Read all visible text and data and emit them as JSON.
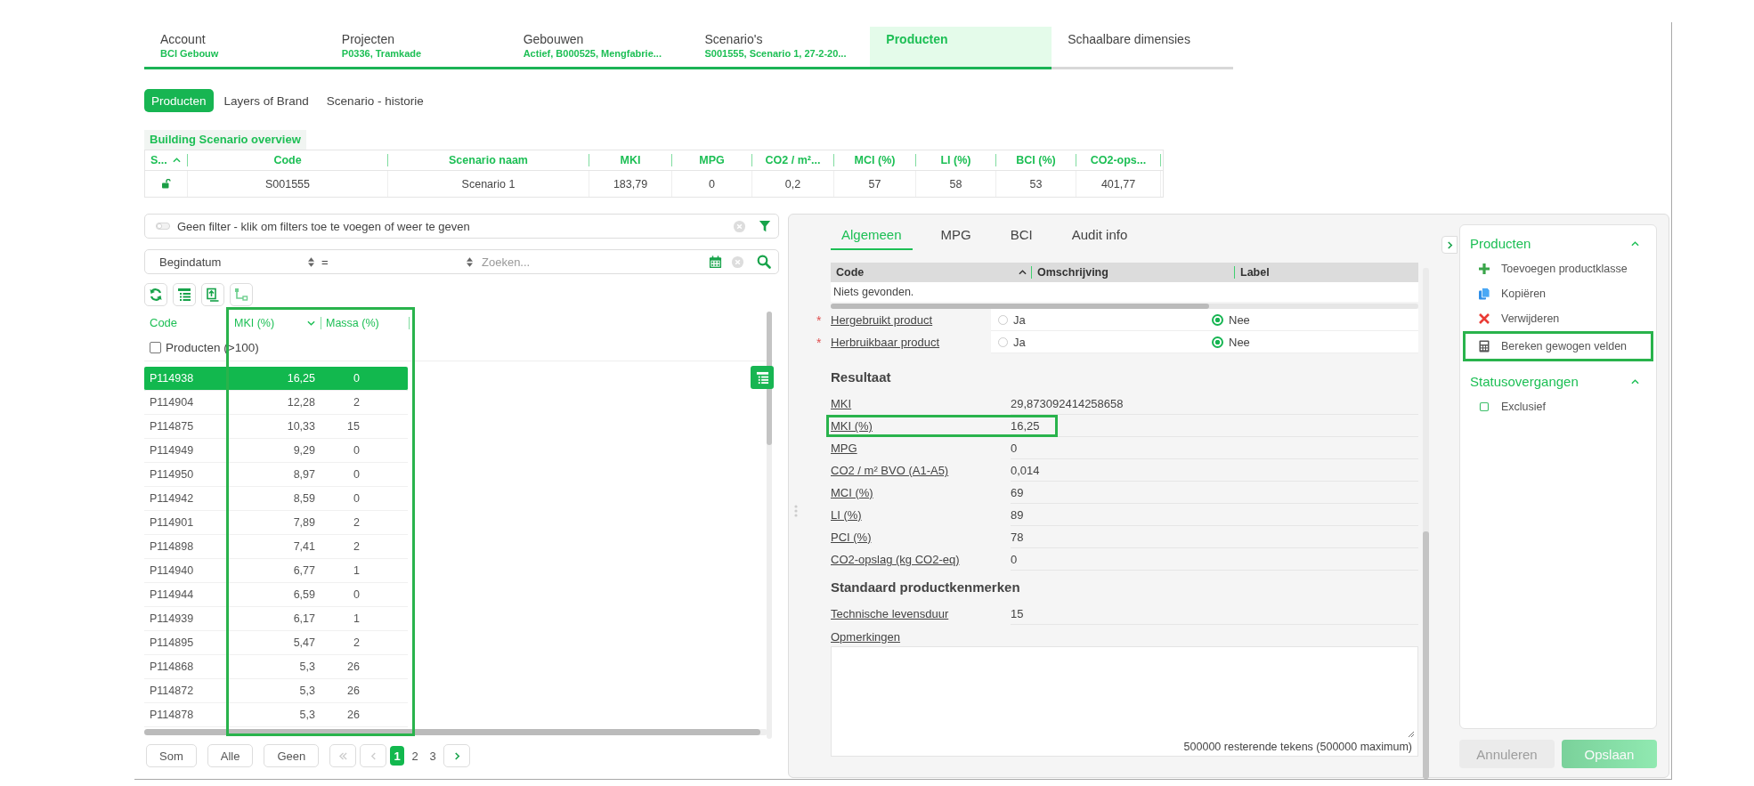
{
  "top_tabs": [
    {
      "label": "Account",
      "sublabel": "BCI Gebouw",
      "selected": false
    },
    {
      "label": "Projecten",
      "sublabel": "P0336, Tramkade",
      "selected": false
    },
    {
      "label": "Gebouwen",
      "sublabel": "Actief, B000525, Mengfabrie...",
      "selected": false
    },
    {
      "label": "Scenario's",
      "sublabel": "S001555, Scenario 1, 27-2-20...",
      "selected": false
    },
    {
      "label": "Producten",
      "selected": true
    },
    {
      "label": "Schaalbare dimensies",
      "selected": false
    }
  ],
  "sub_tabs": [
    {
      "label": "Producten",
      "selected": true
    },
    {
      "label": "Layers of Brand",
      "selected": false
    },
    {
      "label": "Scenario - historie",
      "selected": false
    }
  ],
  "overview": {
    "title": "Building Scenario overview",
    "columns": [
      {
        "label": "S...",
        "ascending": true
      },
      {
        "label": "Code"
      },
      {
        "label": "Scenario naam"
      },
      {
        "label": "MKI"
      },
      {
        "label": "MPG"
      },
      {
        "label": "CO2 / m²..."
      },
      {
        "label": "MCI (%)"
      },
      {
        "label": "LI (%)"
      },
      {
        "label": "BCI (%)"
      },
      {
        "label": "CO2-ops..."
      }
    ],
    "rows": [
      {
        "cells": [
          "",
          "S001555",
          "Scenario 1",
          "183,79",
          "0",
          "0,2",
          "57",
          "58",
          "53",
          "401,77"
        ]
      }
    ]
  },
  "filter_bar": {
    "text": "Geen filter - klik om filters toe te voegen of weer te geven"
  },
  "search_bar": {
    "field": "Begindatum",
    "operator": "=",
    "placeholder": "Zoeken..."
  },
  "products_table": {
    "columns": [
      {
        "label": "Code"
      },
      {
        "label": "MKI (%)",
        "ascending": false
      },
      {
        "label": "Massa (%)"
      }
    ],
    "outlined": true,
    "group": {
      "label": "Producten (>100)",
      "checked": false
    },
    "rows": [
      {
        "code": "P114938",
        "mki": "16,25",
        "massa": "0",
        "selected": true
      },
      {
        "code": "P114904",
        "mki": "12,28",
        "massa": "2",
        "selected": false
      },
      {
        "code": "P114875",
        "mki": "10,33",
        "massa": "15",
        "selected": false
      },
      {
        "code": "P114949",
        "mki": "9,29",
        "massa": "0",
        "selected": false
      },
      {
        "code": "P114950",
        "mki": "8,97",
        "massa": "0",
        "selected": false
      },
      {
        "code": "P114942",
        "mki": "8,59",
        "massa": "0",
        "selected": false
      },
      {
        "code": "P114901",
        "mki": "7,89",
        "massa": "2",
        "selected": false
      },
      {
        "code": "P114898",
        "mki": "7,41",
        "massa": "2",
        "selected": false
      },
      {
        "code": "P114940",
        "mki": "6,77",
        "massa": "1",
        "selected": false
      },
      {
        "code": "P114944",
        "mki": "6,59",
        "massa": "0",
        "selected": false
      },
      {
        "code": "P114939",
        "mki": "6,17",
        "massa": "1",
        "selected": false
      },
      {
        "code": "P114895",
        "mki": "5,47",
        "massa": "2",
        "selected": false
      },
      {
        "code": "P114868",
        "mki": "5,3",
        "massa": "26",
        "selected": false
      },
      {
        "code": "P114872",
        "mki": "5,3",
        "massa": "26",
        "selected": false
      },
      {
        "code": "P114878",
        "mki": "5,3",
        "massa": "26",
        "selected": false
      }
    ]
  },
  "footer_buttons": [
    "Som",
    "Alle",
    "Geen"
  ],
  "pagination": [
    {
      "label": "1",
      "selected": true
    },
    {
      "label": "2",
      "selected": false
    },
    {
      "label": "3",
      "selected": false
    }
  ],
  "detail": {
    "tabs": [
      {
        "label": "Algemeen",
        "selected": true
      },
      {
        "label": "MPG",
        "selected": false
      },
      {
        "label": "BCI",
        "selected": false
      },
      {
        "label": "Audit info",
        "selected": false
      }
    ],
    "grid_columns": [
      {
        "label": "Code",
        "ascending": true
      },
      {
        "label": "Omschrijving"
      },
      {
        "label": "Label"
      }
    ],
    "empty_text": "Niets gevonden.",
    "questions": [
      {
        "label": "Hergebruikt product",
        "marker": "*",
        "options": [
          {
            "label": "Ja",
            "selected": false
          },
          {
            "label": "Nee",
            "selected": true
          }
        ]
      },
      {
        "label": "Herbruikbaar product",
        "marker": "*",
        "options": [
          {
            "label": "Ja",
            "selected": false
          },
          {
            "label": "Nee",
            "selected": true
          }
        ]
      }
    ],
    "sections": [
      {
        "title": "Resultaat",
        "fields": [
          {
            "label": "MKI",
            "value": "29,873092414258658",
            "highlighted": false
          },
          {
            "label": "MKI (%)",
            "value": "16,25",
            "highlighted": true
          },
          {
            "label": "MPG",
            "value": "0",
            "highlighted": false
          },
          {
            "label": "CO2 / m² BVO (A1-A5)",
            "value": "0,014",
            "highlighted": false
          },
          {
            "label": "MCI (%)",
            "value": "69",
            "highlighted": false
          },
          {
            "label": "LI (%)",
            "value": "89",
            "highlighted": false
          },
          {
            "label": "PCI (%)",
            "value": "78",
            "highlighted": false
          },
          {
            "label": "CO2-opslag (kg CO2-eq)",
            "value": "0",
            "highlighted": false
          }
        ]
      },
      {
        "title": "Standaard productkenmerken",
        "fields": [
          {
            "label": "Technische levensduur",
            "value": "15",
            "highlighted": false
          }
        ]
      }
    ],
    "remarks": {
      "label": "Opmerkingen",
      "counter": "500000 resterende tekens (500000 maximum)"
    }
  },
  "sidebar": {
    "groups": [
      {
        "title": "Producten",
        "expanded": true,
        "items": [
          {
            "label": "Toevoegen productklasse",
            "kind": "add",
            "highlighted": false
          },
          {
            "label": "Kopiëren",
            "kind": "copy",
            "highlighted": false
          },
          {
            "label": "Verwijderen",
            "kind": "delete",
            "highlighted": false
          },
          {
            "label": "Bereken gewogen velden",
            "kind": "calculate",
            "highlighted": true
          }
        ]
      },
      {
        "title": "Statusovergangen",
        "expanded": true,
        "items": [
          {
            "label": "Exclusief",
            "kind": "status",
            "highlighted": false
          }
        ]
      }
    ],
    "buttons": [
      {
        "label": "Annuleren",
        "kind": "secondary",
        "disabled": true
      },
      {
        "label": "Opslaan",
        "kind": "primary",
        "disabled": true
      }
    ]
  }
}
